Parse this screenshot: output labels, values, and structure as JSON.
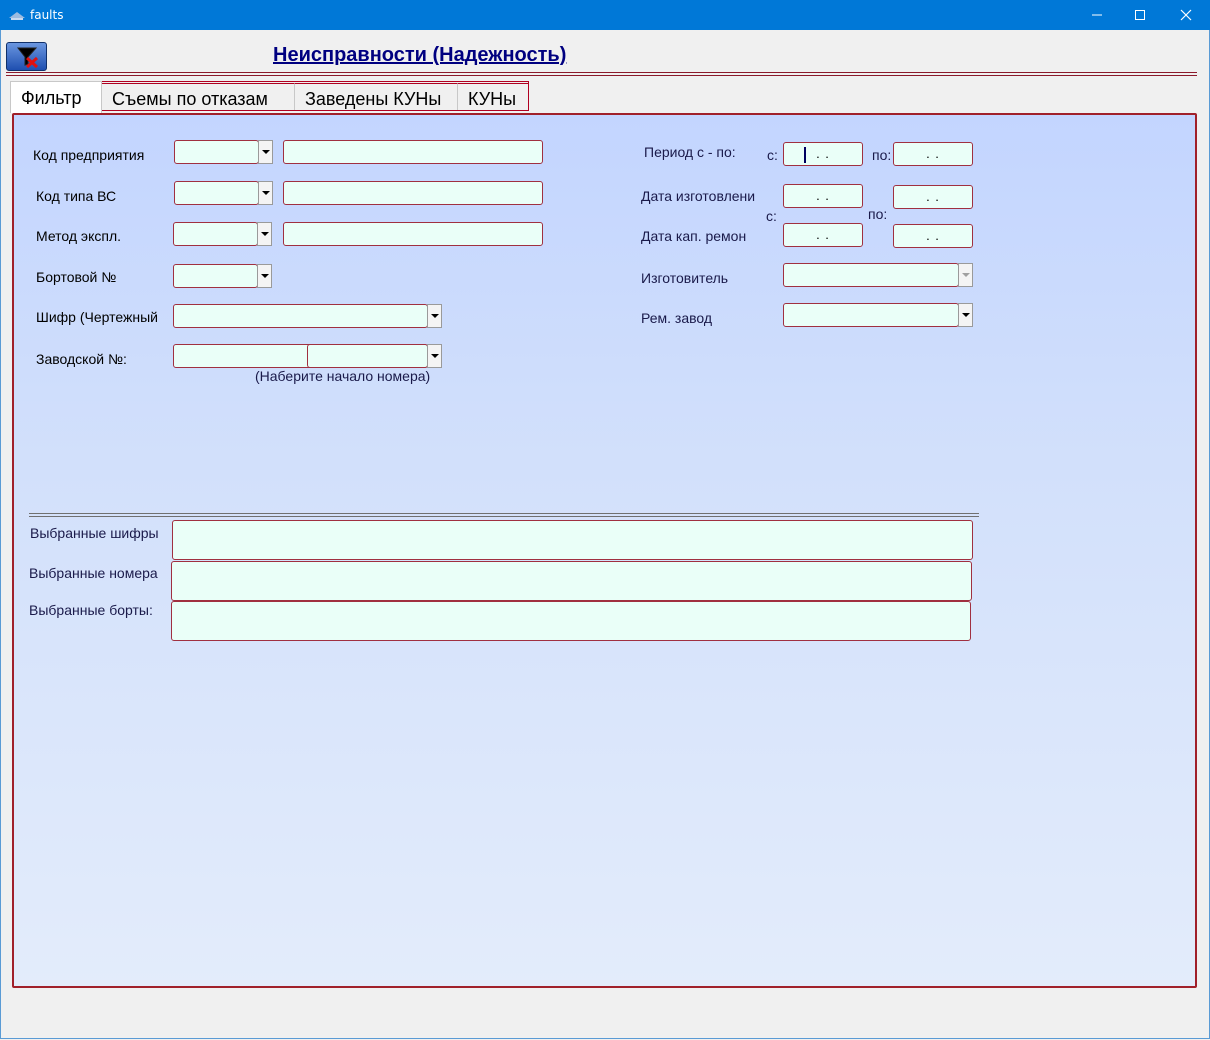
{
  "window": {
    "title": "faults",
    "minimize_glyph": "—",
    "maximize_glyph": "☐",
    "close_glyph": "✕"
  },
  "header": {
    "title": "Неисправности (Надежность)",
    "filter_button_icon": "filter-clear-icon"
  },
  "tabs": [
    {
      "label": "Фильтр",
      "active": true
    },
    {
      "label": "Съемы по отказам",
      "active": false
    },
    {
      "label": "Заведены КУНы",
      "active": false
    },
    {
      "label": "КУНы",
      "active": false
    }
  ],
  "filter": {
    "enterprise_code_label": "Код предприятия",
    "aircraft_type_label": "Код типа ВС",
    "operation_method_label": "Метод экспл.",
    "board_number_label": "Бортовой №",
    "cipher_label": "Шифр (Чертежный",
    "serial_number_label": "Заводской №:",
    "serial_hint": "(Наберите начало номера)",
    "period_label": "Период с - по:",
    "from_label": "с:",
    "to_label": "по:",
    "manufacture_date_label": "Дата изготовлени",
    "overhaul_date_label": "Дата кап.  ремон",
    "manufacturer_label": "Изготовитель",
    "repair_plant_label": "Рем. завод",
    "date_mask": ". .",
    "enterprise_code": "",
    "enterprise_name": "",
    "aircraft_type": "",
    "aircraft_type_name": "",
    "operation_method": "",
    "operation_method_name": "",
    "board_number": "",
    "cipher": "",
    "serial_number": "",
    "manufacturer": "",
    "repair_plant": ""
  },
  "selected": {
    "ciphers_label": "Выбранные шифры",
    "numbers_label": "Выбранные номера",
    "boards_label": "Выбранные борты:"
  },
  "colors": {
    "titlebar": "#0078d7",
    "title_text": "#000080",
    "field_bg": "#eafff8",
    "field_border": "#a03040",
    "panel_border": "#a0202a"
  }
}
